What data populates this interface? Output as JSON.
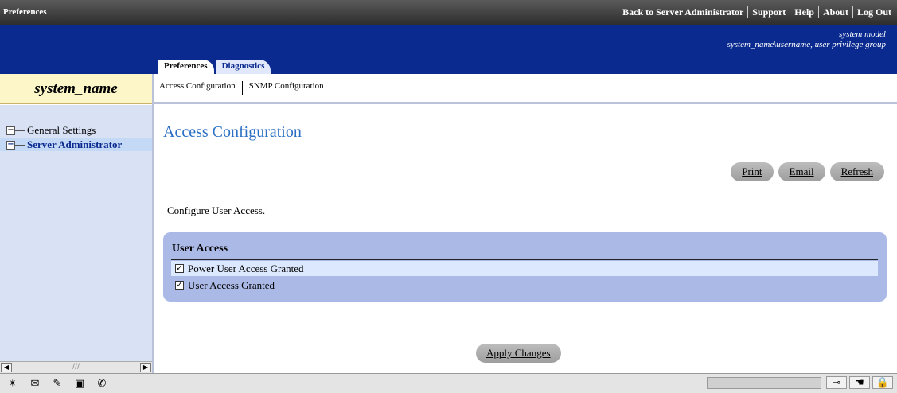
{
  "window": {
    "title": "Preferences"
  },
  "top_links": [
    "Back to Server Administrator",
    "Support",
    "Help",
    "About",
    "Log Out"
  ],
  "system": {
    "model": "system model",
    "user_line": "system_name\\username, user privilege group",
    "name": "system_name"
  },
  "tabs": [
    {
      "label": "Preferences",
      "active": true
    },
    {
      "label": "Diagnostics",
      "active": false
    }
  ],
  "subnav": [
    "Access Configuration",
    "SNMP Configuration"
  ],
  "sidebar": {
    "items": [
      {
        "label": "General Settings",
        "selected": false
      },
      {
        "label": "Server Administrator",
        "selected": true
      }
    ],
    "scroll_grip": "///"
  },
  "main": {
    "title": "Access Configuration",
    "actions": [
      "Print",
      "Email",
      "Refresh"
    ],
    "intro": "Configure User Access.",
    "panel": {
      "title": "User Access",
      "options": [
        {
          "label": "Power User Access Granted",
          "checked": true
        },
        {
          "label": "User Access Granted",
          "checked": true
        }
      ]
    },
    "apply_label": "Apply Changes"
  },
  "glyphs": {
    "check": "✓",
    "minus": "−",
    "left": "◀",
    "right": "▶"
  },
  "statusbar": {
    "icons": [
      "network-icon",
      "mail-icon",
      "compose-icon",
      "address-book-icon",
      "chat-icon"
    ]
  }
}
